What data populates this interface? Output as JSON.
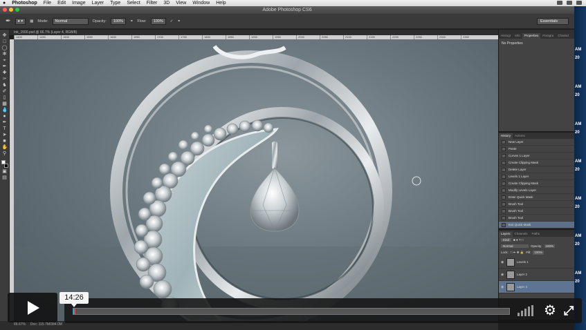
{
  "menubar": {
    "apple": "",
    "app": "Photoshop",
    "items": [
      "File",
      "Edit",
      "Image",
      "Layer",
      "Type",
      "Select",
      "Filter",
      "3D",
      "View",
      "Window",
      "Help"
    ]
  },
  "window": {
    "title": "Adobe Photoshop CS6"
  },
  "options": {
    "mode_label": "Mode:",
    "mode_value": "Normal",
    "opacity_label": "Opacity:",
    "opacity_value": "100%",
    "flow_label": "Flow:",
    "flow_value": "100%",
    "workspace": "Essentials"
  },
  "document": {
    "tab": "Ink_1500.psd @ 66.7% (Layer 4, RGB/8)"
  },
  "ruler": {
    "ticks": [
      "1400",
      "1450",
      "1500",
      "1550",
      "1600",
      "1650",
      "1700",
      "1750",
      "1800",
      "1850",
      "1900",
      "1950",
      "2000",
      "2050",
      "2100",
      "2150",
      "2200",
      "2250",
      "2300",
      "2350"
    ]
  },
  "status": {
    "zoom": "66.67%",
    "doc": "Doc: 115.7M/384.0M"
  },
  "panels": {
    "properties": {
      "tabs": [
        "Histogr",
        "Info",
        "Properties",
        "Paragra",
        "Charact"
      ],
      "active": "Properties",
      "body": "No Properties"
    },
    "history": {
      "tabs": [
        "History",
        "Actions"
      ],
      "active": "History",
      "items": [
        "New Layer",
        "Paste",
        "Curves 1 Layer",
        "Create Clipping Mask",
        "Delete Layer",
        "Levels 1 Layer",
        "Create Clipping Mask",
        "Modify Levels Layer",
        "Enter Quick Mask",
        "Brush Tool",
        "Brush Tool",
        "Brush Tool",
        "Exit Quick Mask"
      ],
      "selected_index": 12
    },
    "layers": {
      "tabs": [
        "Layers",
        "Channels",
        "Paths"
      ],
      "active": "Layers",
      "kind_label": "Kind",
      "blend": "Normal",
      "opacity_label": "Opacity:",
      "opacity_value": "100%",
      "lock_label": "Lock:",
      "fill_label": "Fill:",
      "fill_value": "100%",
      "rows": [
        {
          "name": "Levels 1",
          "selected": false
        },
        {
          "name": "Layer 2",
          "selected": false
        },
        {
          "name": "Layer 4",
          "selected": true
        }
      ]
    }
  },
  "desktop": {
    "labels": [
      "AM",
      "20",
      "AM",
      "20",
      "AM",
      "20",
      "AM",
      "20",
      "AM",
      "20",
      "AM",
      "20",
      "AM",
      "20"
    ]
  },
  "video": {
    "current_time": "14:26",
    "progress": 0.003
  },
  "colors": {
    "accent": "#1ab7ea",
    "scrub": "#ff3b30"
  },
  "icons": {
    "play": "play-icon",
    "volume": "volume-bars-icon",
    "settings": "gear-icon",
    "fullscreen": "fullscreen-icon"
  }
}
